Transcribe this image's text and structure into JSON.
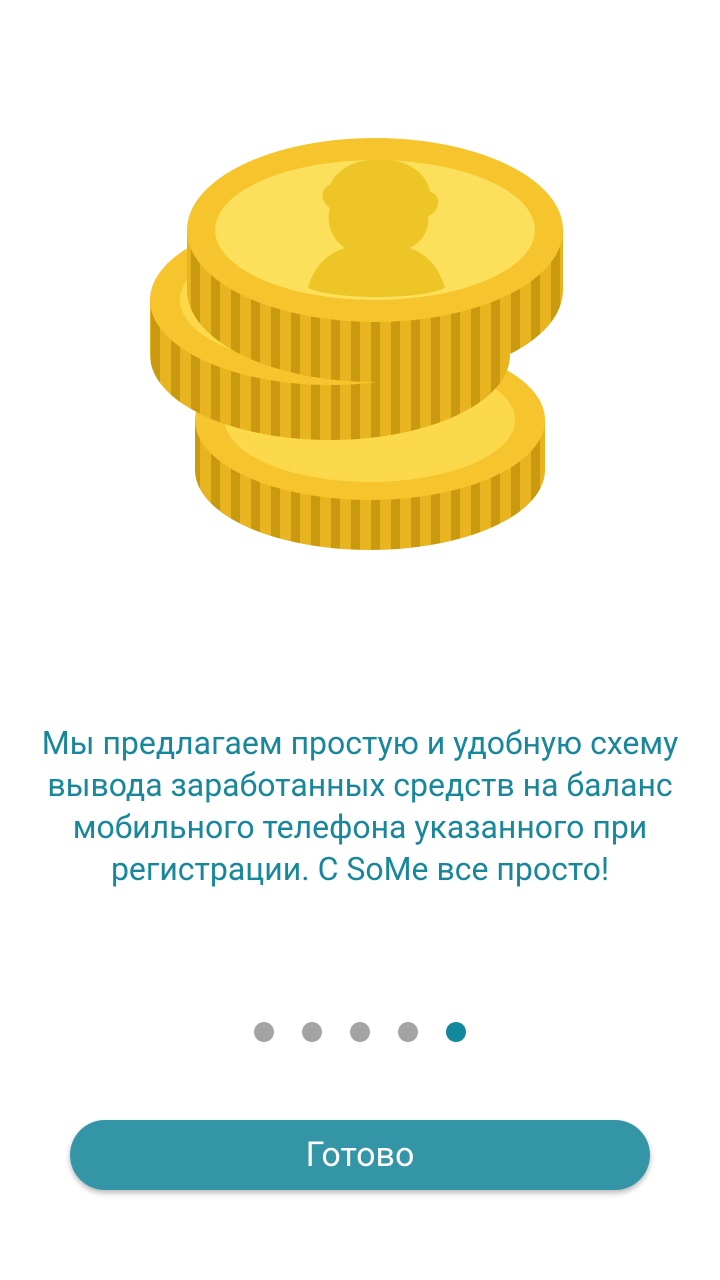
{
  "onboarding": {
    "illustration_icon": "coin-stack-icon",
    "description": "Мы предлагаем простую и удобную схему вывода заработанных средств на баланс мобильного телефона указанного при регистрации. С SoMe все просто!",
    "pager": {
      "total": 5,
      "current": 5
    },
    "done_label": "Готово"
  },
  "colors": {
    "text_accent": "#18879b",
    "button": "#3395a6",
    "dot_inactive": "#a3a3a3",
    "dot_active": "#12889c",
    "coin_face": "#fcd94a",
    "coin_rim": "#f6c42c",
    "coin_edge": "#e8b420",
    "coin_edge_dark": "#c9990f"
  }
}
